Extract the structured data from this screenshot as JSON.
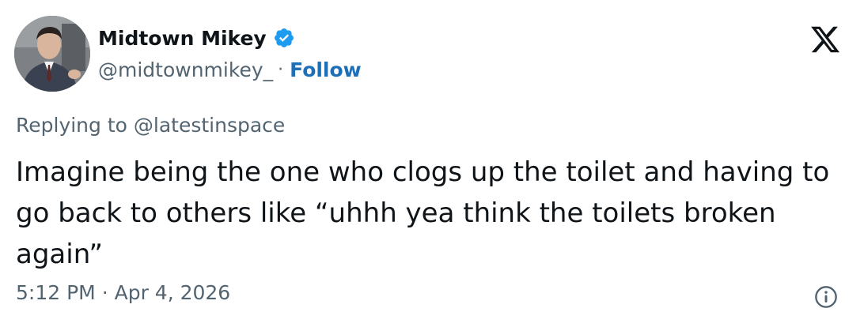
{
  "author": {
    "display_name": "Midtown Mikey",
    "handle": "@midtownmikey_",
    "separator": "·",
    "follow_label": "Follow",
    "verified_icon": "verified-badge-icon",
    "verified_color": "#1d9bf0"
  },
  "reply": {
    "prefix": "Replying to ",
    "to_handle": "@latestinspace"
  },
  "tweet": {
    "text": "Imagine being the one who clogs up the toilet and having to go back to others like “uhhh yea think the toilets broken again”"
  },
  "meta": {
    "time": "5:12 PM",
    "separator": "·",
    "date": "Apr 4, 2026"
  },
  "icons": {
    "brand": "x-logo-icon",
    "info": "info-icon"
  },
  "colors": {
    "text": "#0f1419",
    "secondary": "#536471",
    "follow": "#1d6fb8"
  }
}
